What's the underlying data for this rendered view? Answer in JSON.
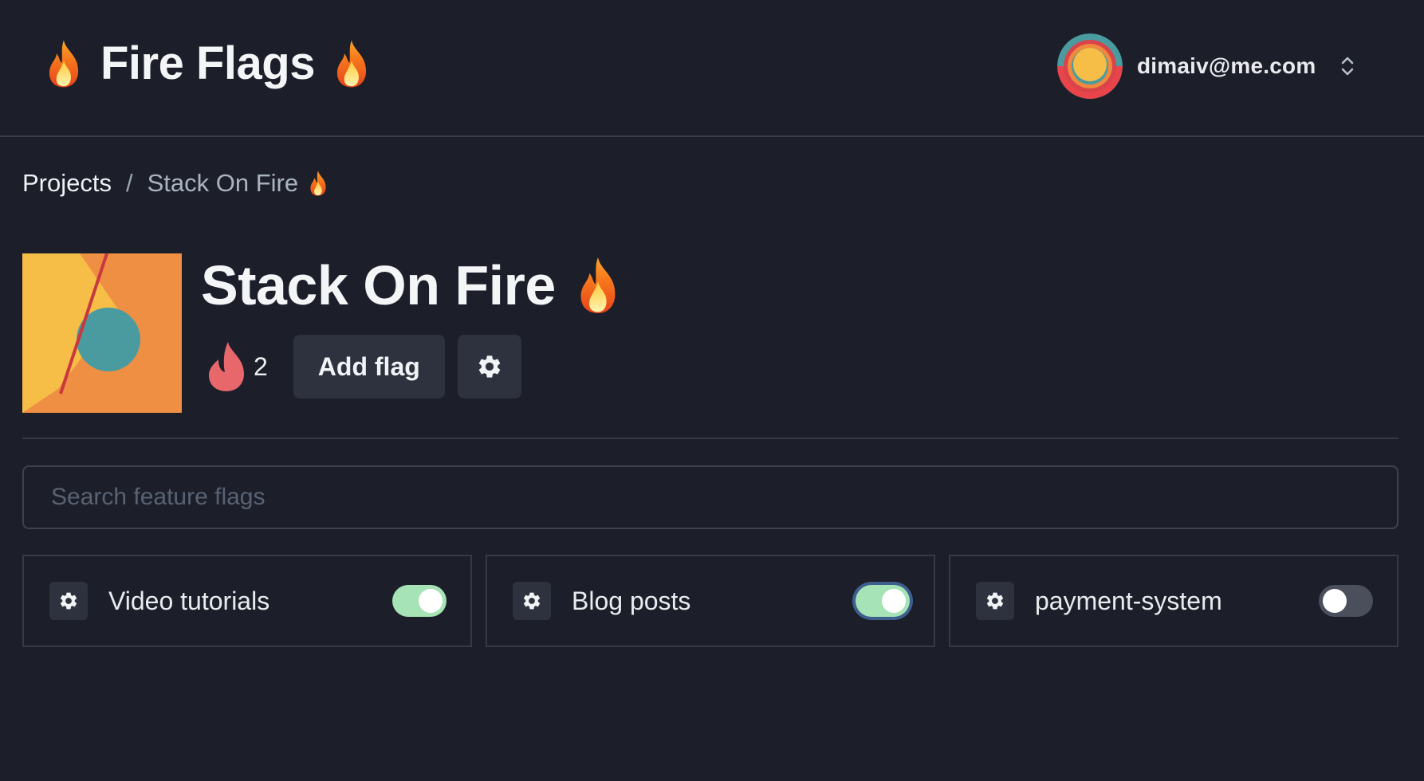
{
  "header": {
    "app_title": "Fire Flags",
    "user": {
      "email": "dimaiv@me.com"
    }
  },
  "breadcrumb": {
    "root_label": "Projects",
    "separator": "/",
    "current_label": "Stack On Fire"
  },
  "project": {
    "title": "Stack On Fire",
    "flag_count": "2",
    "add_flag_label": "Add flag"
  },
  "search": {
    "placeholder": "Search feature flags",
    "value": ""
  },
  "flags": [
    {
      "name": "Video tutorials",
      "enabled": true
    },
    {
      "name": "Blog posts",
      "enabled": true
    },
    {
      "name": "payment-system",
      "enabled": false
    }
  ],
  "colors": {
    "background": "#1c1f29",
    "button_bg": "#2d323e",
    "toggle_on": "#a6e3b6",
    "toggle_off": "#4a4f5b",
    "flame_red": "#e8676a",
    "focus_ring": "#3e5f8e"
  },
  "icons": {
    "brand": "fire-emoji-icon",
    "user_menu": "chevron-up-down-icon",
    "flag_count": "flame-icon",
    "settings": "gear-icon"
  }
}
